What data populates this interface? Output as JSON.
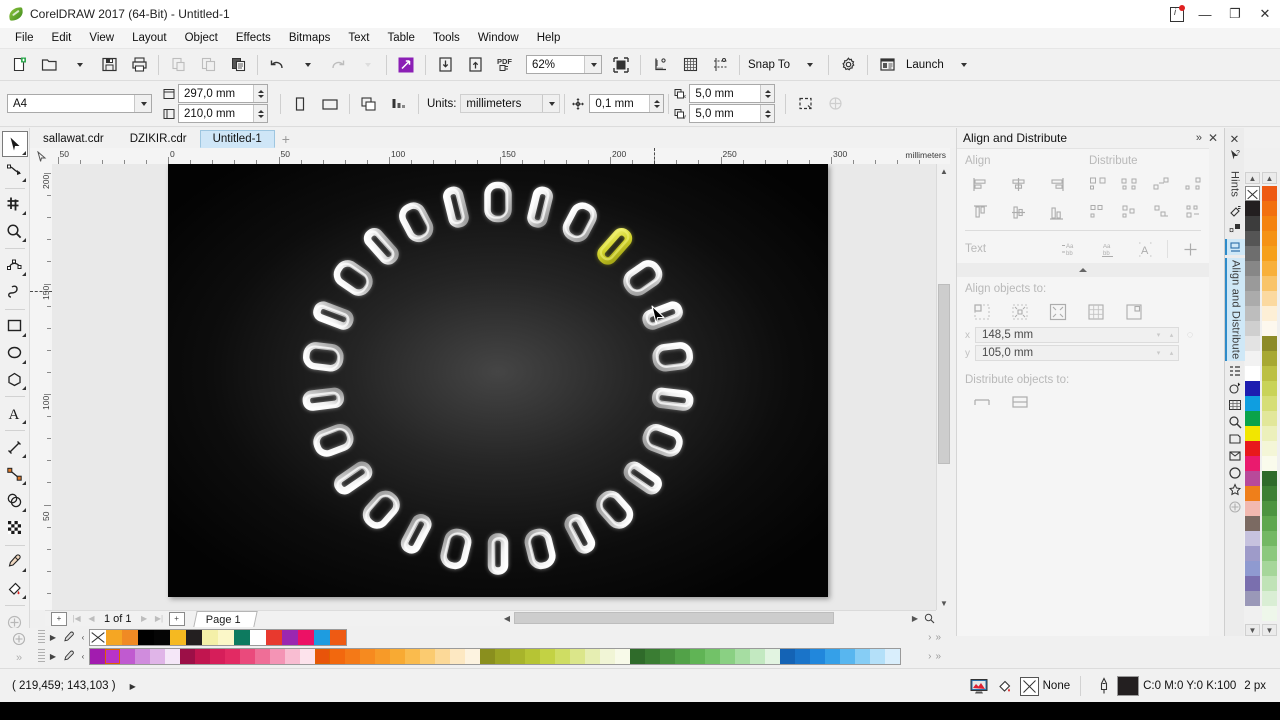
{
  "window": {
    "title": "CorelDRAW 2017 (64-Bit) - Untitled-1",
    "logo_icon": "coreldraw-balloon-icon",
    "notification_icon": "notification-icon",
    "minimize_label": "—",
    "restore_label": "❐",
    "close_label": "✕"
  },
  "menubar": {
    "items": [
      {
        "label": "File",
        "accel": "F"
      },
      {
        "label": "Edit",
        "accel": "E"
      },
      {
        "label": "View",
        "accel": "V"
      },
      {
        "label": "Layout",
        "accel": "L"
      },
      {
        "label": "Object",
        "accel": "O"
      },
      {
        "label": "Effects",
        "accel": "c"
      },
      {
        "label": "Bitmaps",
        "accel": "B"
      },
      {
        "label": "Text",
        "accel": "x"
      },
      {
        "label": "Table",
        "accel": "T"
      },
      {
        "label": "Tools",
        "accel": "o"
      },
      {
        "label": "Window",
        "accel": "W"
      },
      {
        "label": "Help",
        "accel": "H"
      }
    ]
  },
  "standard_toolbar": {
    "buttons": [
      {
        "name": "new-document-button",
        "tip": "New"
      },
      {
        "name": "open-document-button",
        "tip": "Open"
      },
      {
        "name": "save-document-button",
        "tip": "Save"
      },
      {
        "name": "print-button",
        "tip": "Print"
      },
      {
        "name": "cut-button",
        "tip": "Cut",
        "disabled": true
      },
      {
        "name": "copy-button",
        "tip": "Copy",
        "disabled": true
      },
      {
        "name": "paste-button",
        "tip": "Paste"
      },
      {
        "name": "undo-button",
        "tip": "Undo"
      },
      {
        "name": "redo-button",
        "tip": "Redo",
        "disabled": true
      },
      {
        "name": "corel-connect-button",
        "tip": "Search Content"
      },
      {
        "name": "import-button",
        "tip": "Import"
      },
      {
        "name": "export-button",
        "tip": "Export"
      },
      {
        "name": "publish-pdf-button",
        "tip": "Publish to PDF"
      }
    ],
    "zoom_level": "62%",
    "fullscreen_label": "Full-Screen Preview",
    "snap_to_label": "Snap To",
    "options_label": "Options",
    "launch_label": "Launch",
    "view_buttons": [
      {
        "name": "show-rulers-button"
      },
      {
        "name": "show-grid-button"
      },
      {
        "name": "show-guidelines-button"
      }
    ]
  },
  "property_bar": {
    "page_size": "A4",
    "page_width": "297,0 mm",
    "page_height": "210,0 mm",
    "orientation_portrait": "Portrait",
    "orientation_landscape": "Landscape",
    "all_pages_label": "All Pages",
    "current_page_label": "Current Page",
    "units_label": "Units:",
    "units_value": "millimeters",
    "nudge_value": "0,1 mm",
    "duplicate_x": "5,0 mm",
    "duplicate_y": "5,0 mm",
    "treat_as_filled_label": "Treat All Objects as Filled",
    "wireframe_label": "Wireframe"
  },
  "document_tabs": {
    "tabs": [
      {
        "label": "sallawat.cdr",
        "active": false
      },
      {
        "label": "DZIKIR.cdr",
        "active": false
      },
      {
        "label": "Untitled-1",
        "active": true
      }
    ],
    "new_tab_label": "+"
  },
  "toolbox": {
    "tools": [
      {
        "name": "pick-tool",
        "label": "Pick",
        "selected": true,
        "flyout": true
      },
      {
        "name": "shape-tool",
        "label": "Shape",
        "flyout": true
      },
      {
        "name": "crop-tool",
        "label": "Crop",
        "flyout": true
      },
      {
        "name": "zoom-tool",
        "label": "Zoom",
        "flyout": true
      },
      {
        "name": "freehand-tool",
        "label": "Freehand",
        "flyout": true
      },
      {
        "name": "smart-fill-tool",
        "label": "Smart Fill",
        "flyout": false
      },
      {
        "name": "rectangle-tool",
        "label": "Rectangle",
        "flyout": true
      },
      {
        "name": "ellipse-tool",
        "label": "Ellipse",
        "flyout": true
      },
      {
        "name": "polygon-tool",
        "label": "Polygon",
        "flyout": true
      },
      {
        "name": "text-tool",
        "label": "Text",
        "flyout": true
      },
      {
        "name": "parallel-dimension-tool",
        "label": "Parallel Dimension",
        "flyout": true
      },
      {
        "name": "straight-line-connector-tool",
        "label": "Straight-Line Connector",
        "flyout": true
      },
      {
        "name": "drop-shadow-tool",
        "label": "Drop Shadow",
        "flyout": true
      },
      {
        "name": "transparency-tool",
        "label": "Transparency",
        "flyout": false
      },
      {
        "name": "color-eyedropper-tool",
        "label": "Color Eyedropper",
        "flyout": true
      },
      {
        "name": "interactive-fill-tool",
        "label": "Interactive Fill",
        "flyout": true
      },
      {
        "name": "quick-customize-tool",
        "label": "Quick Customize",
        "flyout": false
      }
    ]
  },
  "rulers": {
    "unit_label": "millimeters",
    "horizontal_labels": [
      "50",
      "0",
      "50",
      "100",
      "150",
      "200",
      "250",
      "300"
    ],
    "vertical_labels": [
      "200",
      "150",
      "100",
      "50"
    ]
  },
  "canvas": {
    "artwork_name": "chain-necklace-artwork",
    "background_color": "#0a0a0a",
    "chain_link_color": "#e9e9e9",
    "highlight_link_color": "#cccc33",
    "link_count": 26,
    "highlighted_link_index": 3
  },
  "page_navigator": {
    "first_label": "|◀",
    "prev_label": "◀",
    "counter": "1 of 1",
    "next_label": "▶",
    "last_label": "▶|",
    "add_page_start_label": "+",
    "add_page_end_label": "+",
    "page_tab_label": "Page 1"
  },
  "palette_bottom": {
    "row1_name": "document-palette",
    "row2_name": "default-palette",
    "eyedropper_icon": "eyedropper-icon",
    "row1": [
      "none",
      "#f5a623",
      "#f08a24",
      "#000000",
      "#050505",
      "#f5b921",
      "#231f20",
      "#f4f0a8",
      "#fbf7c8",
      "#0d7a5f",
      "#ffffff",
      "#e8392e",
      "#9b27b0",
      "#ec1165",
      "#1e9ce0",
      "#ee5a13"
    ],
    "row2": [
      "#a21caf",
      "#b833c9",
      "#c05ad0",
      "#d08cdd",
      "#e0b5e8",
      "#f5e7f8",
      "#9c0f47",
      "#c1154f",
      "#d61e5a",
      "#e22a63",
      "#ea4a7c",
      "#ef6e97",
      "#f494b5",
      "#f9bdd2",
      "#fde3ec",
      "#e8540a",
      "#f2680e",
      "#f47917",
      "#f68a1f",
      "#f79a28",
      "#f8aa33",
      "#fabb4d",
      "#fbcb70",
      "#fcd998",
      "#fde8c2",
      "#fdf3e0",
      "#8a8f1e",
      "#9aa324",
      "#a8b42b",
      "#b6c434",
      "#c3d244",
      "#cfdd63",
      "#dbe68a",
      "#e6eeb2",
      "#f1f5d6",
      "#f8fae9",
      "#2f6b2a",
      "#3a7d33",
      "#46903d",
      "#52a248",
      "#60b455",
      "#72c268",
      "#8ad083",
      "#a6dda2",
      "#c3e9c1",
      "#e2f4e1",
      "#1463b5",
      "#1a74c9",
      "#2187dc",
      "#35a0e8",
      "#58b6ef",
      "#86cdf5",
      "#b4e0f9",
      "#d9eefc"
    ]
  },
  "docker": {
    "title": "Align and Distribute",
    "collapse_icon": "chevrons-right-icon",
    "close_icon": "close-icon",
    "align_label": "Align",
    "distribute_label": "Distribute",
    "text_label": "Text",
    "align_objects_to_label": "Align objects to:",
    "distribute_objects_to_label": "Distribute objects to:",
    "x_value": "148,5 mm",
    "y_value": "105,0 mm",
    "x_label": "x",
    "y_label": "y",
    "align_buttons": [
      "align-left",
      "align-center-horizontally",
      "align-right",
      "align-top",
      "align-center-vertically",
      "align-bottom"
    ],
    "distribute_buttons": [
      "distribute-left",
      "distribute-center-h",
      "distribute-space-h",
      "distribute-right",
      "distribute-top",
      "distribute-center-v",
      "distribute-space-v",
      "distribute-bottom"
    ],
    "text_buttons": [
      "text-first-line-baseline",
      "text-last-line-baseline",
      "text-bounding-box",
      "text-outline"
    ],
    "align_to_buttons": [
      "align-to-active-object",
      "align-to-selection-center",
      "align-to-page-edge",
      "align-to-grid",
      "align-to-page-center"
    ],
    "distribute_to_buttons": [
      "distribute-to-selection-extent",
      "distribute-to-page-extent"
    ]
  },
  "docker_tabs": {
    "items": [
      {
        "name": "hints-tab",
        "label": "Hints",
        "active": false
      },
      {
        "name": "object-properties-tab",
        "label": "",
        "active": false
      },
      {
        "name": "object-manager-tab",
        "label": "",
        "active": false
      },
      {
        "name": "align-and-distribute-tab",
        "label": "Align and Distribute",
        "active": true
      },
      {
        "name": "object-styles-tab",
        "label": "",
        "active": false
      },
      {
        "name": "transformations-tab",
        "label": "",
        "active": false
      },
      {
        "name": "tables-tab",
        "label": "",
        "active": false
      },
      {
        "name": "find-replace-tab",
        "label": "",
        "active": false
      },
      {
        "name": "shaping-tab",
        "label": "",
        "active": false
      },
      {
        "name": "envelope-tab",
        "label": "",
        "active": false
      },
      {
        "name": "lens-tab",
        "label": "",
        "active": false
      },
      {
        "name": "symbol-manager-tab",
        "label": "",
        "active": false
      },
      {
        "name": "customize-tab",
        "label": "",
        "active": false
      }
    ]
  },
  "palette_right": {
    "column_a": [
      "none",
      "#231f20",
      "#3c3c3c",
      "#555555",
      "#6e6e6e",
      "#878787",
      "#9a9a9a",
      "#ababab",
      "#bdbdbd",
      "#cfcfcf",
      "#e3e3e3",
      "#f2f2f2",
      "#ffffff",
      "#1d1db0",
      "#0f9ee0",
      "#0aa34a",
      "#f2e600",
      "#e8191c",
      "#ea1a6e",
      "#b84a9a",
      "#ef7f1a",
      "#f2b9b0",
      "#7b6a62",
      "#c6c2de",
      "#9e9bc9",
      "#8f9ad0",
      "#7a6fae",
      "#9a98b8"
    ],
    "column_b": [
      "#ee5a13",
      "#f2700f",
      "#f4830f",
      "#f59214",
      "#f6a01b",
      "#f8b03a",
      "#f9c469",
      "#fbd9a0",
      "#fdefd6",
      "#fdf8ee",
      "#8d8b28",
      "#a7a832",
      "#bcc043",
      "#c9d358",
      "#d6de76",
      "#e2e79a",
      "#ecf0bb",
      "#f4f6d7",
      "#fafbec",
      "#2f6b2a",
      "#3d8034",
      "#4d9440",
      "#5fa74e",
      "#74b863",
      "#8cc87d",
      "#a6d69a",
      "#c0e3b7",
      "#d9eed4",
      "#eef7ea"
    ],
    "scroll_up_icon": "chevron-up-icon",
    "scroll_down_icon": "chevron-down-icon"
  },
  "statusbar": {
    "coordinates": "( 219,459; 143,103 )",
    "expand_icon": "triangle-right-icon",
    "color_proof_icon": "color-proof-icon",
    "fill_icon": "fill-icon",
    "fill_value": "None",
    "outline_icon": "outline-pen-icon",
    "outline_color_hex": "#231f20",
    "outline_color_value": "C:0 M:0 Y:0 K:100",
    "outline_width": "2 px"
  }
}
